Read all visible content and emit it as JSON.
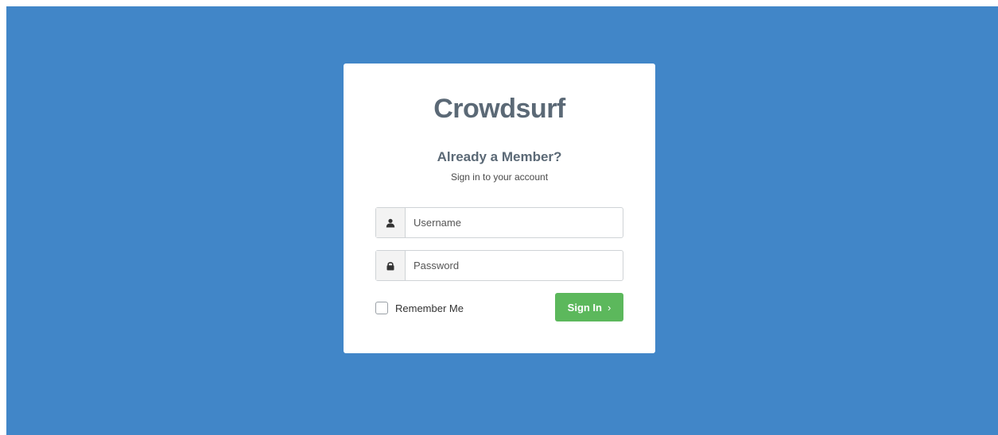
{
  "brand": {
    "name": "Crowdsurf"
  },
  "login": {
    "heading": "Already a Member?",
    "subheading": "Sign in to your account",
    "username": {
      "placeholder": "Username",
      "value": "",
      "icon": "user-icon"
    },
    "password": {
      "placeholder": "Password",
      "value": "",
      "icon": "lock-icon"
    },
    "remember_label": "Remember Me",
    "remember_checked": false,
    "signin_label": "Sign In",
    "signin_chevron": "›"
  },
  "colors": {
    "background": "#4186c8",
    "card": "#ffffff",
    "brand_text": "#5b6976",
    "signin_button": "#5cb85c"
  }
}
